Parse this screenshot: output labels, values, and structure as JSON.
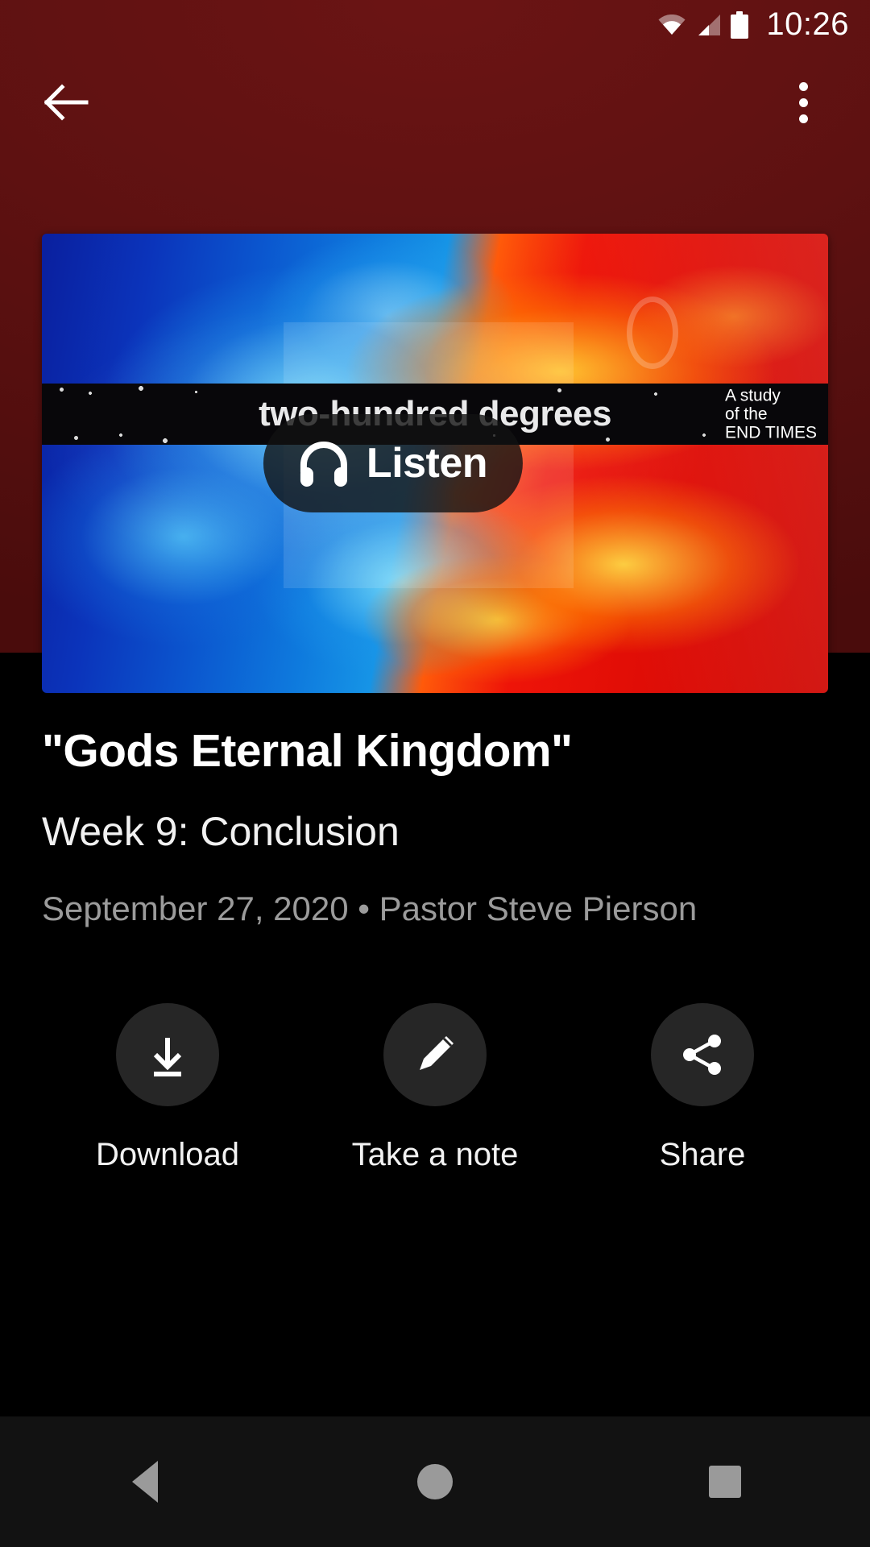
{
  "status_bar": {
    "time": "10:26",
    "icons": [
      "wifi-icon",
      "signal-icon",
      "battery-icon"
    ]
  },
  "app_bar": {
    "back_icon": "back-arrow-icon",
    "overflow_icon": "more-vertical-icon"
  },
  "thumbnail": {
    "banner_title": "two-hundred degrees",
    "banner_subtitle": "A study\nof the\nEND TIMES",
    "listen_label": "Listen",
    "listen_icon": "headphones-icon"
  },
  "detail": {
    "title": "\"Gods Eternal Kingdom\"",
    "subtitle": "Week 9: Conclusion",
    "meta": "September 27, 2020 • Pastor Steve Pierson"
  },
  "actions": [
    {
      "label": "Download",
      "icon": "download-icon"
    },
    {
      "label": "Take a note",
      "icon": "pencil-icon"
    },
    {
      "label": "Share",
      "icon": "share-icon"
    }
  ],
  "nav_bar": {
    "back_label": "back-triangle-icon",
    "home_label": "home-circle-icon",
    "recents_label": "recents-square-icon"
  },
  "colors": {
    "header": "#5e1111",
    "background": "#000000",
    "action_circle": "#262626",
    "meta_text": "#9b9b9b",
    "nav_bar": "#121212"
  }
}
